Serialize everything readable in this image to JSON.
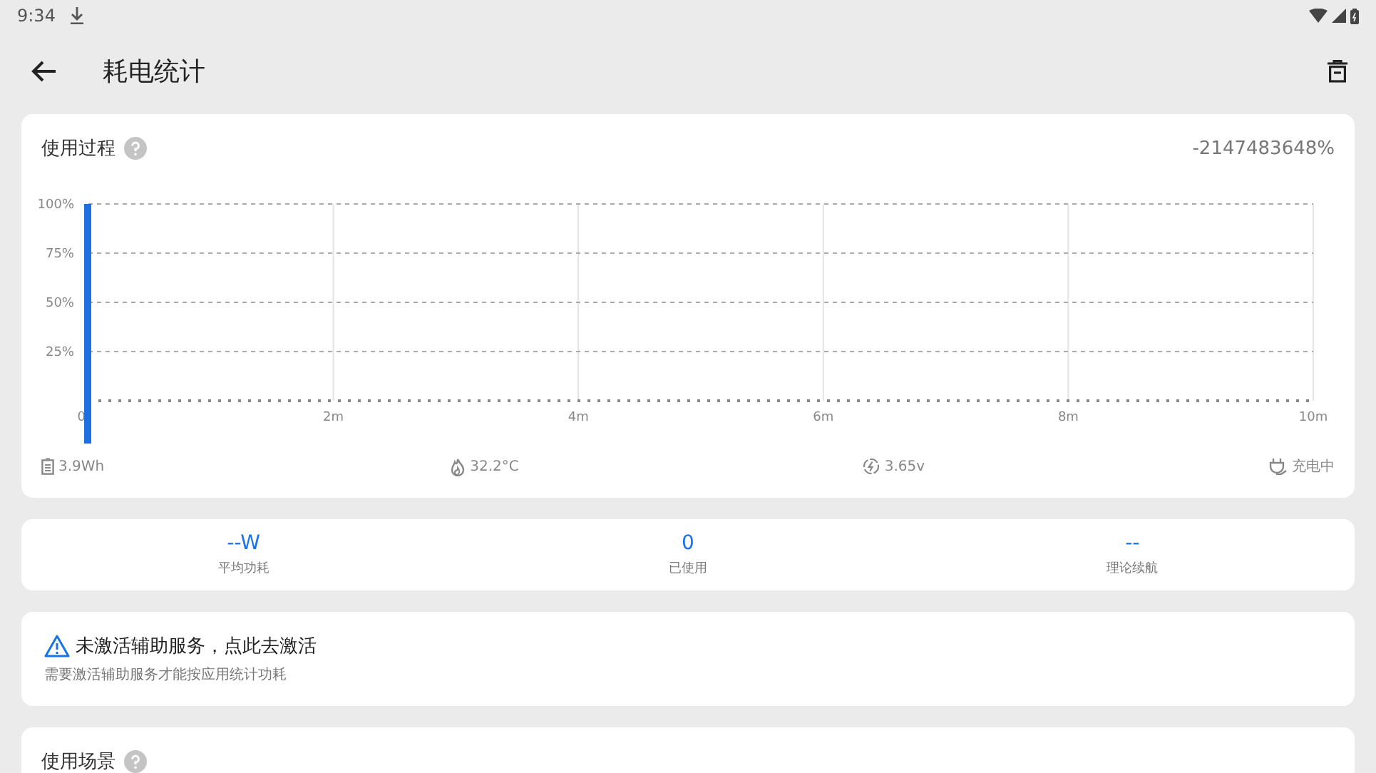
{
  "status_bar": {
    "time": "9:34"
  },
  "app_bar": {
    "title": "耗电统计"
  },
  "usage_card": {
    "title": "使用过程",
    "value": "-2147483648%",
    "chart_data": {
      "type": "bar",
      "grid": true,
      "x": [
        0
      ],
      "values": [
        100
      ],
      "xlim": [
        0,
        10
      ],
      "ylim": [
        0,
        100
      ],
      "xticks": [
        {
          "value": 0,
          "label": "0"
        },
        {
          "value": 2,
          "label": "2m"
        },
        {
          "value": 4,
          "label": "4m"
        },
        {
          "value": 6,
          "label": "6m"
        },
        {
          "value": 8,
          "label": "8m"
        },
        {
          "value": 10,
          "label": "10m"
        }
      ],
      "yticks": [
        {
          "value": 25,
          "label": "25%"
        },
        {
          "value": 50,
          "label": "50%"
        },
        {
          "value": 75,
          "label": "75%"
        },
        {
          "value": 100,
          "label": "100%"
        }
      ]
    },
    "footer": [
      {
        "kind": "battery",
        "text": "3.9Wh"
      },
      {
        "kind": "temperature",
        "text": "32.2°C"
      },
      {
        "kind": "voltage",
        "text": "3.65v"
      },
      {
        "kind": "charging",
        "text": "充电中"
      }
    ]
  },
  "stats": [
    {
      "value": "--W",
      "label": "平均功耗"
    },
    {
      "value": "0",
      "label": "已使用"
    },
    {
      "value": "--",
      "label": "理论续航"
    }
  ],
  "notice": {
    "title": "未激活辅助服务，点此去激活",
    "subtitle": "需要激活辅助服务才能按应用统计功耗"
  },
  "scene_card": {
    "title": "使用场景"
  }
}
